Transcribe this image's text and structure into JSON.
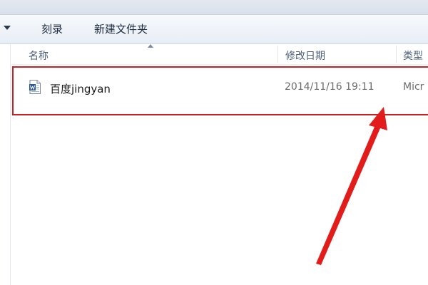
{
  "toolbar": {
    "burn_label": "刻录",
    "new_folder_label": "新建文件夹"
  },
  "columns": {
    "name": "名称",
    "date_modified": "修改日期",
    "type": "类型"
  },
  "file": {
    "name": "百度jingyan",
    "date_modified": "2014/11/16 19:11",
    "type": "Micr",
    "icon": "word-document-icon"
  },
  "colors": {
    "annotation": "#e21b1b",
    "highlight_border": "#cc1f1f"
  }
}
